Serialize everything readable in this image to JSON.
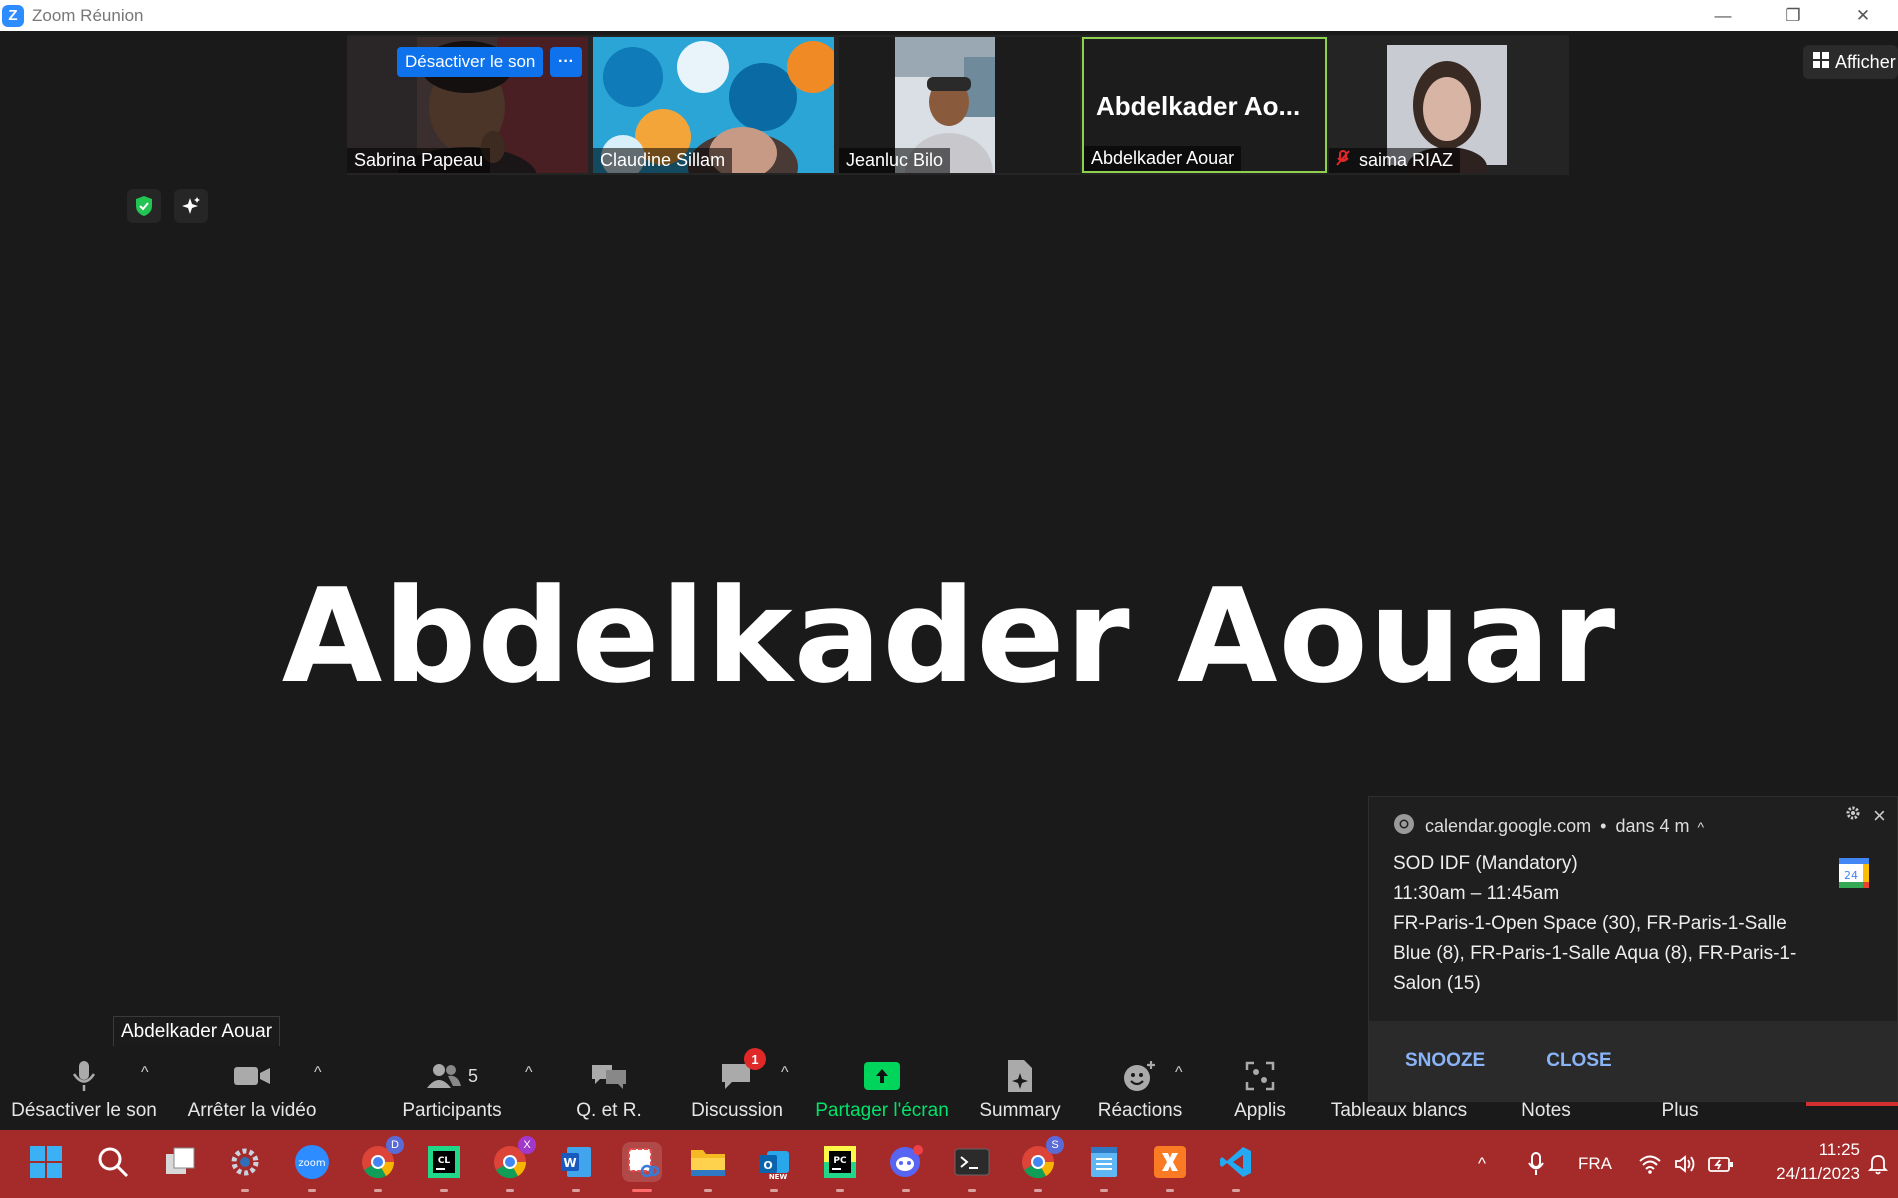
{
  "window": {
    "title": "Zoom Réunion",
    "logo": "Z",
    "controls": [
      "—",
      "❐",
      "✕"
    ]
  },
  "view_button": {
    "label": "Afficher",
    "icon": "grid-icon"
  },
  "participants": [
    {
      "name": "Sabrina Papeau",
      "unmute_label": "Désactiver le son",
      "more_label": "···"
    },
    {
      "name": "Claudine Sillam"
    },
    {
      "name": "Jeanluc Bilo"
    },
    {
      "name": "Abdelkader Aouar",
      "tile_title": "Abdelkader  Ao..."
    },
    {
      "name": "saima RIAZ",
      "muted": true
    }
  ],
  "active_speaker": {
    "name": "Abdelkader Aouar"
  },
  "tooltip": {
    "text": "Abdelkader Aouar"
  },
  "toolbar": {
    "mute": "Désactiver le son",
    "video": "Arrêter la vidéo",
    "participants": "Participants",
    "participants_count": "5",
    "qa": "Q. et R.",
    "chat": "Discussion",
    "chat_badge": "1",
    "share": "Partager l'écran",
    "summary": "Summary",
    "reactions": "Réactions",
    "apps": "Applis",
    "whiteboards": "Tableaux blancs",
    "notes": "Notes",
    "more": "Plus",
    "share_color": "#00d45a"
  },
  "notification": {
    "source": "calendar.google.com",
    "time": "dans 4 m",
    "title": "SOD IDF (Mandatory)",
    "hours": "11:30am – 11:45am",
    "location": "FR-Paris-1-Open Space (30), FR-Paris-1-Salle Blue (8), FR-Paris-1-Salle Aqua (8), FR-Paris-1-Salon (15)",
    "calendar_day": "24",
    "snooze": "SNOOZE",
    "close": "CLOSE",
    "accent": "#8ab4f8"
  },
  "taskbar": {
    "language": "FRA",
    "time": "11:25",
    "date": "24/11/2023",
    "background": "#a52a2a"
  }
}
